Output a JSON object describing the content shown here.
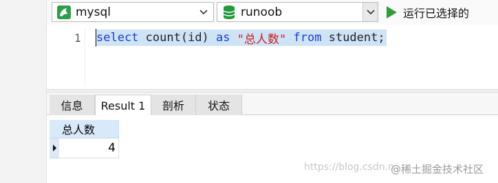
{
  "toolbar": {
    "connection": "mysql",
    "database": "runoob",
    "run_label": "运行已选择的"
  },
  "editor": {
    "line_number": "1",
    "tokens": {
      "select": "select",
      "count": "count(id)",
      "as": "as",
      "alias": "\"总人数\"",
      "from": "from",
      "table": "student;"
    }
  },
  "tabs": [
    "信息",
    "Result 1",
    "剖析",
    "状态"
  ],
  "result": {
    "columns": [
      "总人数"
    ],
    "rows": [
      [
        "4"
      ]
    ]
  },
  "watermark": {
    "url": "https://blog.csdn.n",
    "brand": "@稀土掘金技术社区"
  },
  "colors": {
    "keyword": "#1a3cd6",
    "string": "#c81e1e",
    "selection": "#cfe3f7",
    "run_icon": "#2e9e3a"
  }
}
